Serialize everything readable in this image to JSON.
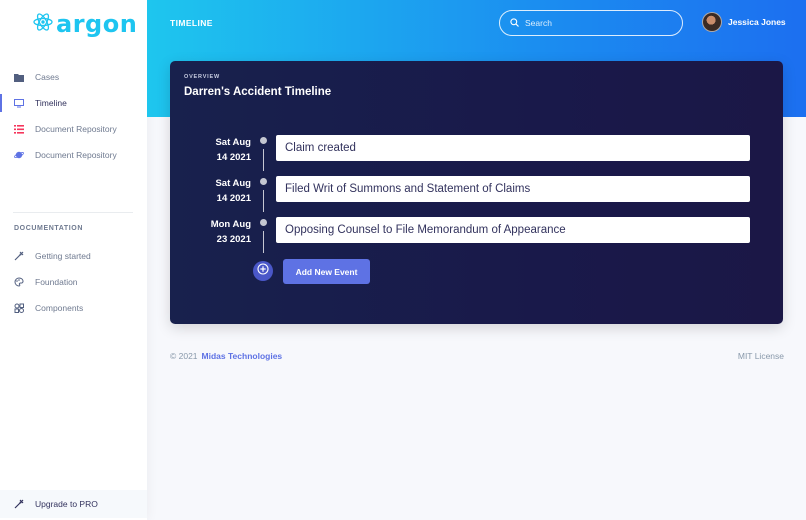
{
  "brand": {
    "name": "argon",
    "icon": "react-atom-icon",
    "color": "#1ec5f0"
  },
  "sidebar": {
    "items": [
      {
        "label": "Cases",
        "icon": "folder-icon"
      },
      {
        "label": "Timeline",
        "icon": "monitor-icon",
        "active": true
      },
      {
        "label": "Document Repository",
        "icon": "list-icon"
      },
      {
        "label": "Document Repository",
        "icon": "planet-icon"
      }
    ],
    "documentation_heading": "DOCUMENTATION",
    "doc_items": [
      {
        "label": "Getting started",
        "icon": "spaceship-icon"
      },
      {
        "label": "Foundation",
        "icon": "palette-icon"
      },
      {
        "label": "Components",
        "icon": "ui-components-icon"
      }
    ],
    "upgrade_label": "Upgrade to PRO"
  },
  "header": {
    "page_label": "TIMELINE",
    "search_placeholder": "Search",
    "user_name": "Jessica Jones"
  },
  "card": {
    "overline": "OVERVIEW",
    "title": "Darren's Accident Timeline",
    "events": [
      {
        "date_line1": "Sat Aug",
        "date_line2": "14 2021",
        "text": "Claim created"
      },
      {
        "date_line1": "Sat Aug",
        "date_line2": "14 2021",
        "text": "Filed Writ of Summons and Statement of Claims"
      },
      {
        "date_line1": "Mon Aug",
        "date_line2": "23 2021",
        "text": "Opposing Counsel to File Memorandum of Appearance"
      }
    ],
    "add_button_label": "Add New Event"
  },
  "footer": {
    "copyright": "© 2021",
    "company": "Midas Technologies",
    "license": "MIT License"
  },
  "colors": {
    "accent": "#5e72e4",
    "header_gradient_start": "#1ec6ee",
    "header_gradient_end": "#1c6ff0",
    "card_background": "#18214d"
  }
}
